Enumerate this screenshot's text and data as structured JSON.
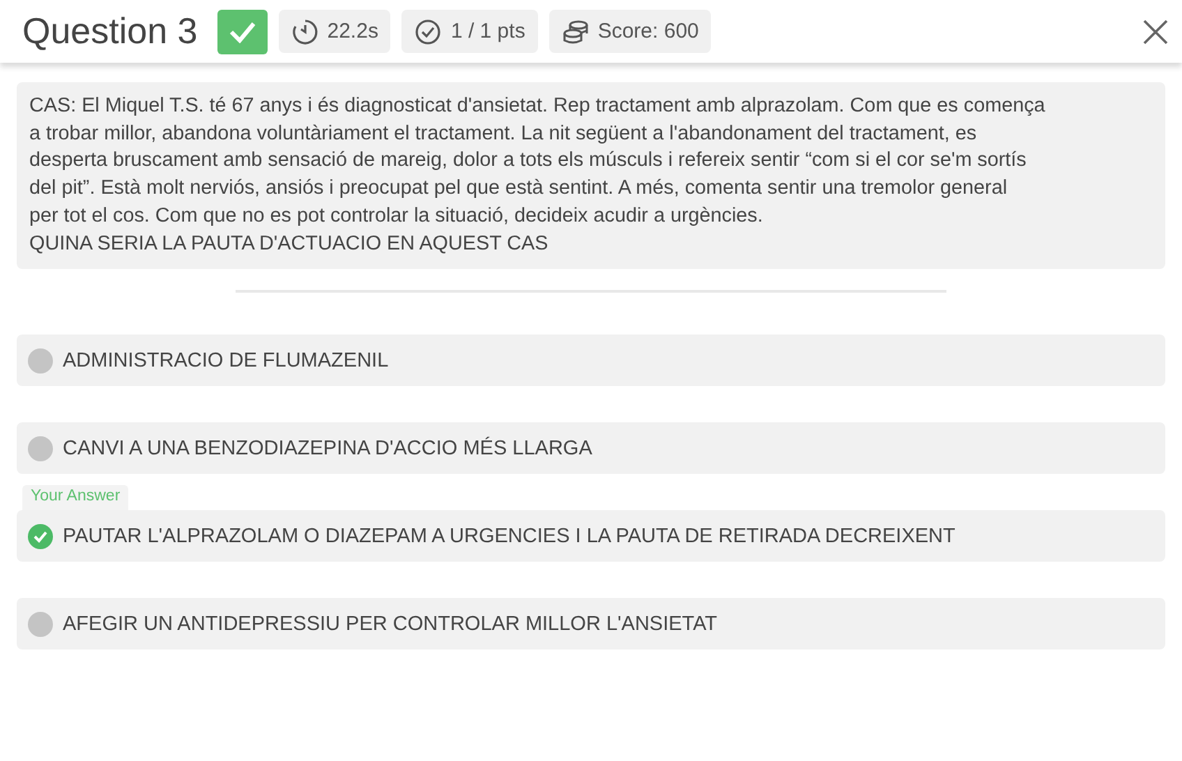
{
  "header": {
    "title": "Question 3",
    "correct": true,
    "time": "22.2s",
    "points": "1 / 1 pts",
    "score": "Score: 600"
  },
  "question": {
    "text": "CAS: El Miquel T.S. té 67 anys i és diagnosticat d'ansietat. Rep tractament amb alprazolam. Com que es comença\na trobar millor, abandona voluntàriament el tractament. La nit següent a l'abandonament del tractament, es\ndesperta bruscament amb sensació de mareig, dolor a tots els músculs i refereix sentir “com si el cor se'm sortís\ndel pit”. Està molt nerviós, ansiós i preocupat pel que està sentint. A més, comenta sentir una tremolor general\nper tot el cos. Com que no es pot controlar la situació, decideix acudir a urgències.\nQUINA SERIA LA PAUTA D'ACTUACIO EN AQUEST CAS"
  },
  "options": [
    {
      "label": "ADMINISTRACIO DE FLUMAZENIL",
      "selected": false
    },
    {
      "label": "CANVI A UNA BENZODIAZEPINA D'ACCIO MÉS LLARGA",
      "selected": false
    },
    {
      "label": "PAUTAR L'ALPRAZOLAM O DIAZEPAM A URGENCIES I LA PAUTA DE RETIRADA DECREIXENT",
      "selected": true,
      "tag": "Your Answer"
    },
    {
      "label": "AFEGIR UN ANTIDEPRESSIU PER CONTROLAR MILLOR L'ANSIETAT",
      "selected": false
    }
  ]
}
